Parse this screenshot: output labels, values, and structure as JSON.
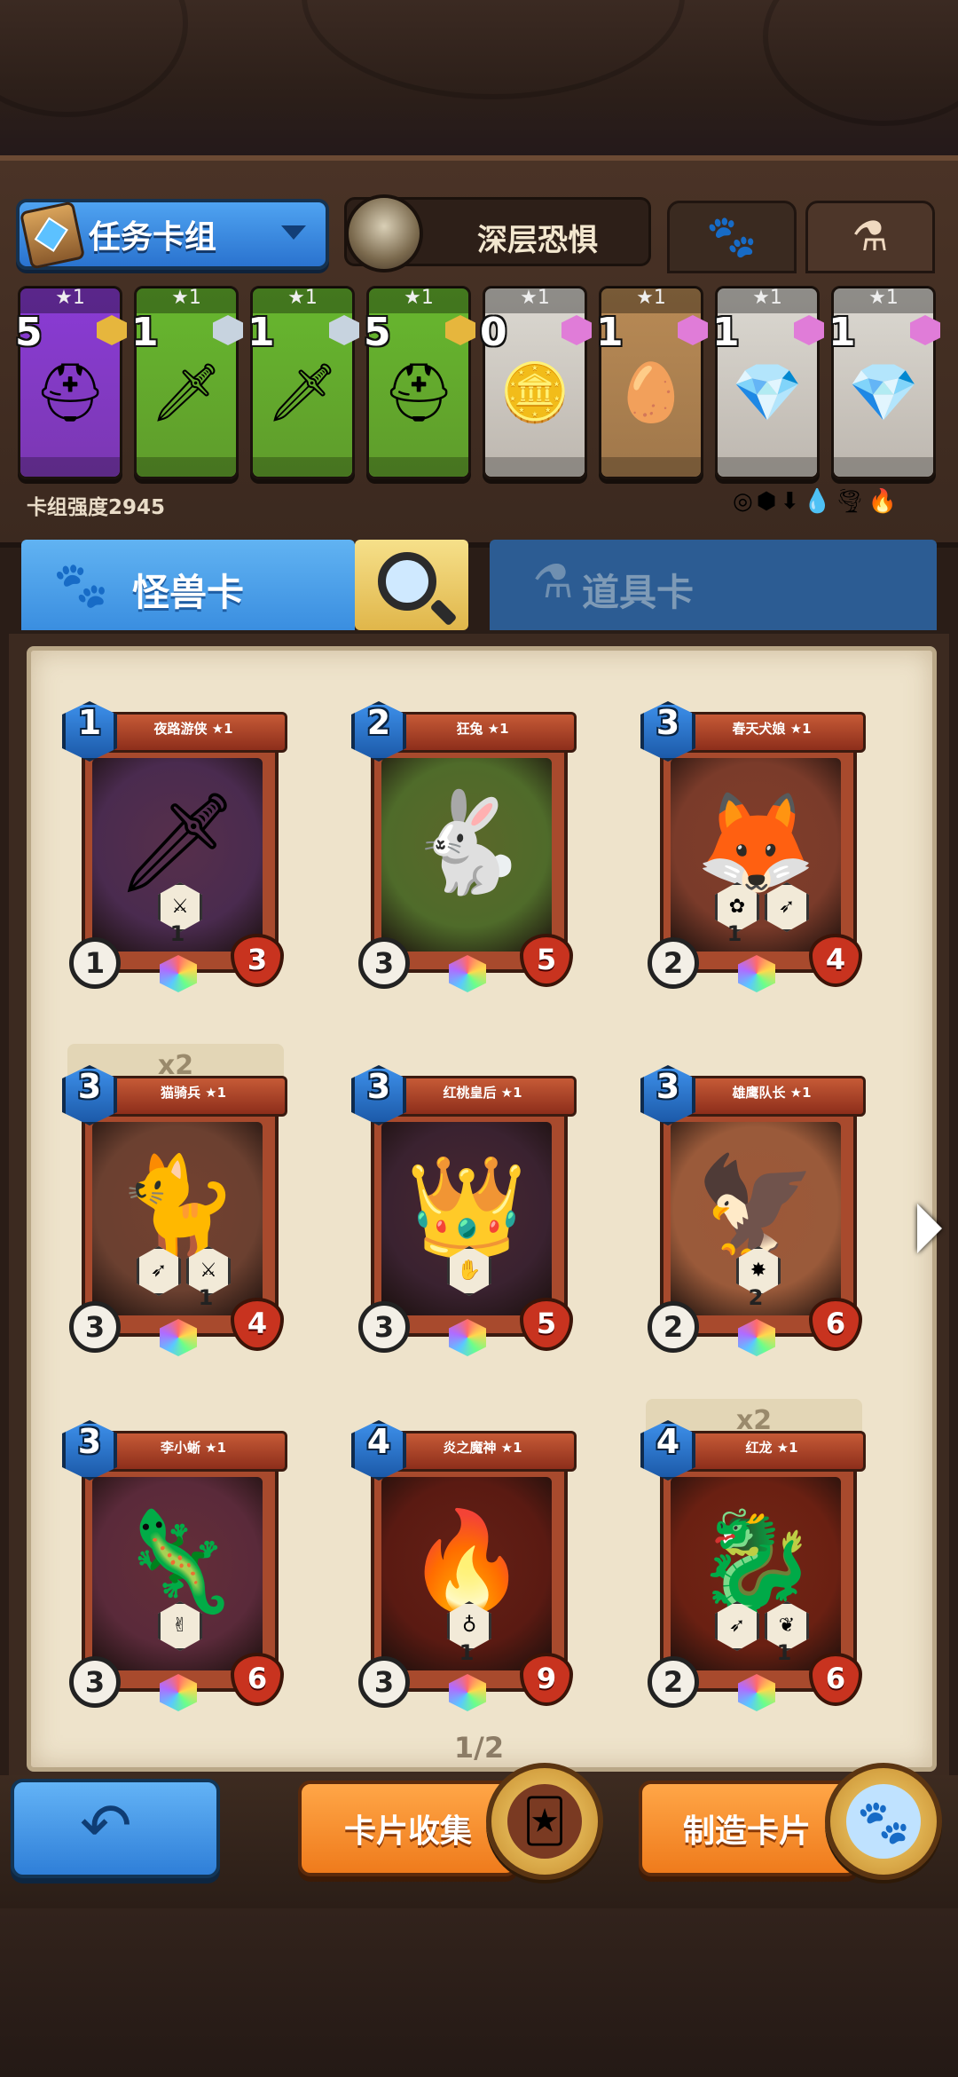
{
  "deck": {
    "selector_label": "任务卡组",
    "boss_name": "深层恐惧",
    "strength_label": "卡组强度2945",
    "tabs": [
      "paw-icon",
      "potion-icon"
    ],
    "cards": [
      {
        "star": "★1",
        "cost": "5",
        "color": "#8a3bd6",
        "gem": "#e6b63d",
        "icon": "⛑"
      },
      {
        "star": "★1",
        "cost": "1",
        "color": "#67b82e",
        "gem": "#c7d3df",
        "icon": "🗡"
      },
      {
        "star": "★1",
        "cost": "1",
        "color": "#67b82e",
        "gem": "#c7d3df",
        "icon": "🗡"
      },
      {
        "star": "★1",
        "cost": "5",
        "color": "#67b82e",
        "gem": "#e6b63d",
        "icon": "⛑"
      },
      {
        "star": "★1",
        "cost": "0",
        "color": "#dcd9d2",
        "gem": "#e07cd8",
        "icon": "🪙"
      },
      {
        "star": "★1",
        "cost": "1",
        "color": "#b88a55",
        "gem": "#e07cd8",
        "icon": "🥚"
      },
      {
        "star": "★1",
        "cost": "1",
        "color": "#dcd9d2",
        "gem": "#e07cd8",
        "icon": "💎"
      },
      {
        "star": "★1",
        "cost": "1",
        "color": "#dcd9d2",
        "gem": "#e07cd8",
        "icon": "💎"
      }
    ],
    "element_icons": "◎⬢⬇💧🌪🔥"
  },
  "tabs": {
    "monster_label": "怪兽卡",
    "items_label": "道具卡"
  },
  "collection": {
    "cards": [
      {
        "name": "夜路游侠 ★1",
        "cost": "1",
        "atk": "1",
        "hp": "3",
        "bg": "#4a2b4f",
        "glyph": "🗡",
        "effects": [
          {
            "icon": "⚔",
            "n": "1"
          }
        ],
        "dup": ""
      },
      {
        "name": "狂兔 ★1",
        "cost": "2",
        "atk": "3",
        "hp": "5",
        "bg": "#4f6b2a",
        "glyph": "🐇",
        "effects": [],
        "dup": ""
      },
      {
        "name": "春天犬娘 ★1",
        "cost": "3",
        "atk": "2",
        "hp": "4",
        "bg": "#7a3b2a",
        "glyph": "🦊",
        "effects": [
          {
            "icon": "✿",
            "n": "1"
          },
          {
            "icon": "➶",
            "n": ""
          }
        ],
        "dup": ""
      },
      {
        "name": "猫骑兵 ★1",
        "cost": "3",
        "atk": "3",
        "hp": "4",
        "bg": "#6b4030",
        "glyph": "🐈",
        "effects": [
          {
            "icon": "➶",
            "n": ""
          },
          {
            "icon": "⚔",
            "n": "1"
          }
        ],
        "dup": "x2"
      },
      {
        "name": "红桃皇后 ★1",
        "cost": "3",
        "atk": "3",
        "hp": "5",
        "bg": "#3a2230",
        "glyph": "👑",
        "effects": [
          {
            "icon": "✋",
            "n": ""
          }
        ],
        "dup": ""
      },
      {
        "name": "雄鹰队长 ★1",
        "cost": "3",
        "atk": "2",
        "hp": "6",
        "bg": "#9a5a3a",
        "glyph": "🦅",
        "effects": [
          {
            "icon": "✸",
            "n": "2"
          }
        ],
        "dup": ""
      },
      {
        "name": "李小蜥 ★1",
        "cost": "3",
        "atk": "3",
        "hp": "6",
        "bg": "#5a2a3a",
        "glyph": "🦎",
        "effects": [
          {
            "icon": "✌",
            "n": ""
          }
        ],
        "dup": ""
      },
      {
        "name": "炎之魔神 ★1",
        "cost": "4",
        "atk": "3",
        "hp": "9",
        "bg": "#5a1a12",
        "glyph": "🔥",
        "effects": [
          {
            "icon": "♁",
            "n": "1"
          }
        ],
        "dup": ""
      },
      {
        "name": "红龙 ★1",
        "cost": "4",
        "atk": "2",
        "hp": "6",
        "bg": "#6a2012",
        "glyph": "🐉",
        "effects": [
          {
            "icon": "➶",
            "n": ""
          },
          {
            "icon": "❦",
            "n": "1"
          }
        ],
        "dup": "x2"
      }
    ],
    "page_indicator": "1/2"
  },
  "bottom": {
    "collect_label": "卡片收集",
    "craft_label": "制造卡片"
  }
}
